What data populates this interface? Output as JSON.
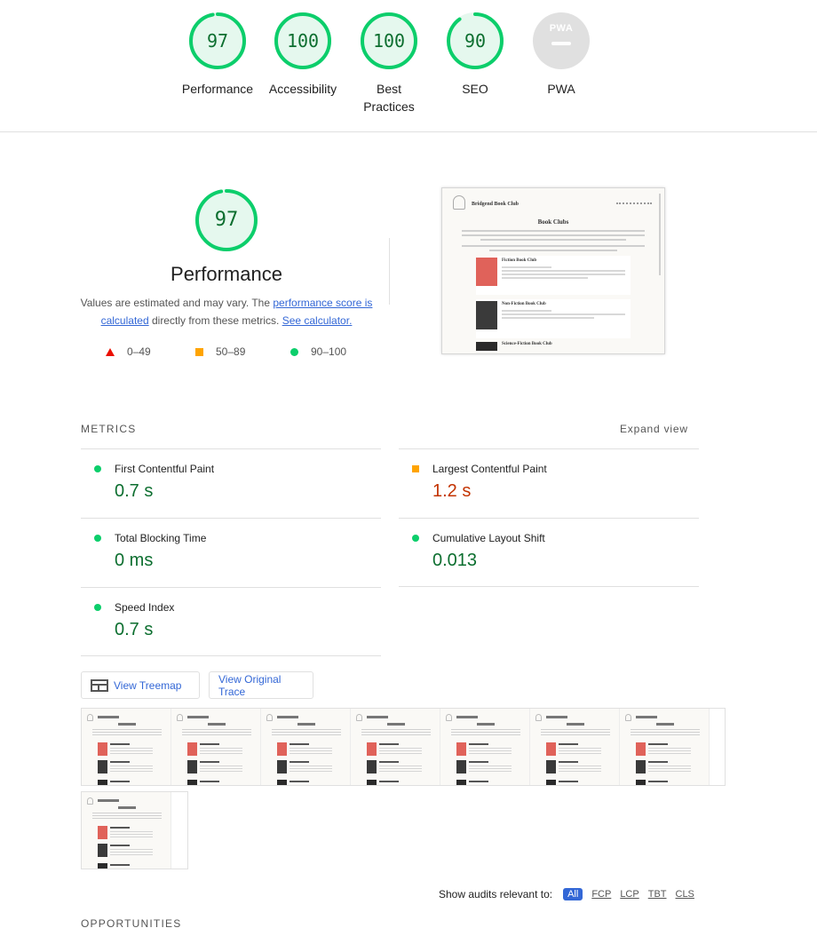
{
  "scores": [
    {
      "label": "Performance",
      "value": "97",
      "fraction": 0.97
    },
    {
      "label": "Accessibility",
      "value": "100",
      "fraction": 1.0
    },
    {
      "label": "Best Practices",
      "value": "100",
      "fraction": 1.0
    },
    {
      "label": "SEO",
      "value": "90",
      "fraction": 0.9
    }
  ],
  "pwa": {
    "badge_text": "PWA",
    "label": "PWA"
  },
  "performance": {
    "score": "97",
    "fraction": 0.97,
    "title": "Performance",
    "desc_prefix": "Values are estimated and may vary. The ",
    "desc_link1": "performance score is calculated",
    "desc_middle": " directly from these metrics. ",
    "desc_link2": "See calculator."
  },
  "legend": {
    "fail": "0–49",
    "average": "50–89",
    "pass": "90–100"
  },
  "screenshot": {
    "site_name": "Bridgend Book Club",
    "page_title": "Book Clubs",
    "cards": [
      "Fiction Book Club",
      "Non-Fiction Book Club",
      "Science-Fiction Book Club"
    ]
  },
  "metrics": {
    "heading": "METRICS",
    "expand": "Expand view",
    "items": [
      {
        "name": "First Contentful Paint",
        "value": "0.7 s",
        "status": "pass"
      },
      {
        "name": "Largest Contentful Paint",
        "value": "1.2 s",
        "status": "average"
      },
      {
        "name": "Total Blocking Time",
        "value": "0 ms",
        "status": "pass"
      },
      {
        "name": "Cumulative Layout Shift",
        "value": "0.013",
        "status": "pass"
      },
      {
        "name": "Speed Index",
        "value": "0.7 s",
        "status": "pass"
      }
    ]
  },
  "buttons": {
    "treemap": "View Treemap",
    "trace": "View Original Trace"
  },
  "filters": {
    "label": "Show audits relevant to:",
    "chips": [
      "All",
      "FCP",
      "LCP",
      "TBT",
      "CLS"
    ]
  },
  "opportunities": {
    "heading": "OPPORTUNITIES"
  },
  "colors": {
    "pass": "#0cce6b",
    "pass_text": "#0c6e2f",
    "average": "#ffa400",
    "fail": "#eb0f00",
    "link": "#3367d6"
  }
}
